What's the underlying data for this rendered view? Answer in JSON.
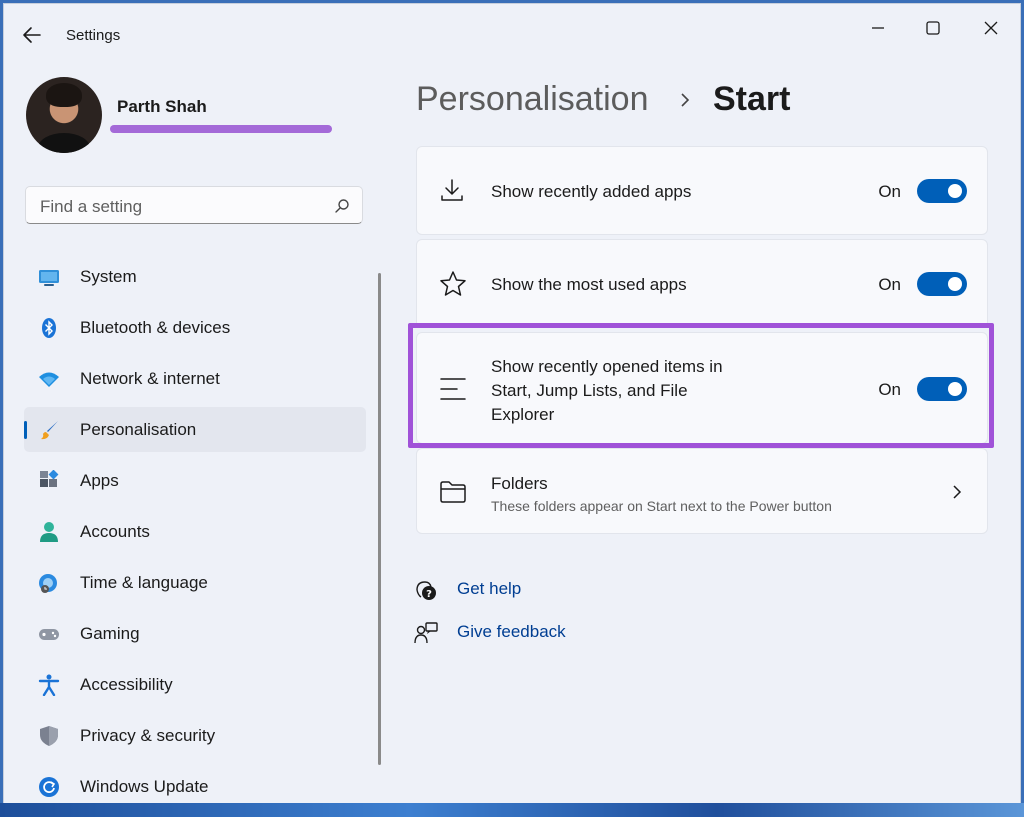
{
  "window": {
    "title": "Settings"
  },
  "profile": {
    "name": "Parth Shah"
  },
  "search": {
    "placeholder": "Find a setting"
  },
  "sidebar": {
    "items": [
      {
        "label": "System",
        "icon": "monitor-icon"
      },
      {
        "label": "Bluetooth & devices",
        "icon": "bluetooth-icon"
      },
      {
        "label": "Network & internet",
        "icon": "wifi-icon"
      },
      {
        "label": "Personalisation",
        "icon": "paintbrush-icon",
        "selected": true
      },
      {
        "label": "Apps",
        "icon": "apps-icon"
      },
      {
        "label": "Accounts",
        "icon": "person-icon"
      },
      {
        "label": "Time & language",
        "icon": "globe-clock-icon"
      },
      {
        "label": "Gaming",
        "icon": "gamepad-icon"
      },
      {
        "label": "Accessibility",
        "icon": "accessibility-icon"
      },
      {
        "label": "Privacy & security",
        "icon": "shield-icon"
      },
      {
        "label": "Windows Update",
        "icon": "update-icon"
      }
    ]
  },
  "breadcrumb": {
    "parent": "Personalisation",
    "current": "Start"
  },
  "settings": [
    {
      "title": "Show recently added apps",
      "state": "On",
      "on": true,
      "icon": "download-icon"
    },
    {
      "title": "Show the most used apps",
      "state": "On",
      "on": true,
      "icon": "star-icon"
    },
    {
      "title_lines": [
        "Show recently opened items in",
        "Start, Jump Lists, and File",
        "Explorer"
      ],
      "state": "On",
      "on": true,
      "icon": "list-lines-icon"
    },
    {
      "title": "Folders",
      "subtitle": "These folders appear on Start next to the Power button",
      "icon": "folder-icon"
    }
  ],
  "links": {
    "help": "Get help",
    "feedback": "Give feedback"
  },
  "colors": {
    "accent": "#005fb8",
    "highlight_box": "#a052d8",
    "link": "#003e92"
  }
}
